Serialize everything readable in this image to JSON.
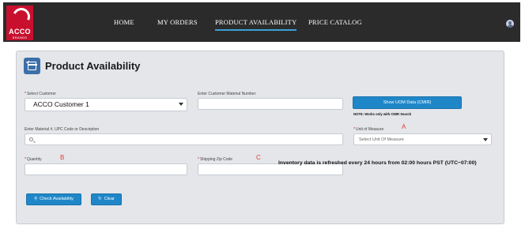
{
  "brand": {
    "logo_text": "ACCO",
    "logo_subtext": "BRANDS",
    "accent": "#c8102e"
  },
  "nav": {
    "items": [
      "HOME",
      "MY ORDERS",
      "PRODUCT AVAILABILITY",
      "PRICE CATALOG"
    ],
    "active": "PRODUCT AVAILABILITY",
    "user_icon": "user-avatar-icon"
  },
  "page": {
    "title": "Product Availability",
    "icon": "checkbox-box-icon"
  },
  "form": {
    "customer": {
      "label": "Select Customer",
      "value": "ACCO Customer 1"
    },
    "customer_material": {
      "label": "Enter Customer Material Number",
      "value": ""
    },
    "uom_button": {
      "label": "Show UOM Data (CMIR)"
    },
    "uom_note": "NOTE: Works only with CMIR Search",
    "material_search": {
      "label": "Enter Material #, UPC Code or Description",
      "value": ""
    },
    "unit_of_measure": {
      "label": "Unit of Measure",
      "placeholder": "Select Unit Of Measure"
    },
    "quantity": {
      "label": "Quantity",
      "value": ""
    },
    "zip": {
      "label": "Shipping Zip Code",
      "value": ""
    },
    "required_mark": "*"
  },
  "markers": {
    "a": "A",
    "b": "B",
    "c": "C",
    "color": "#e03a2f"
  },
  "actions": {
    "check": "Check Availability",
    "clear": "Clear",
    "button_color": "#1f87c8"
  },
  "footer": {
    "refresh_note": "Inventory data is refreshed every 24 hours from 02:00 hours PST (UTC−07:00)"
  }
}
